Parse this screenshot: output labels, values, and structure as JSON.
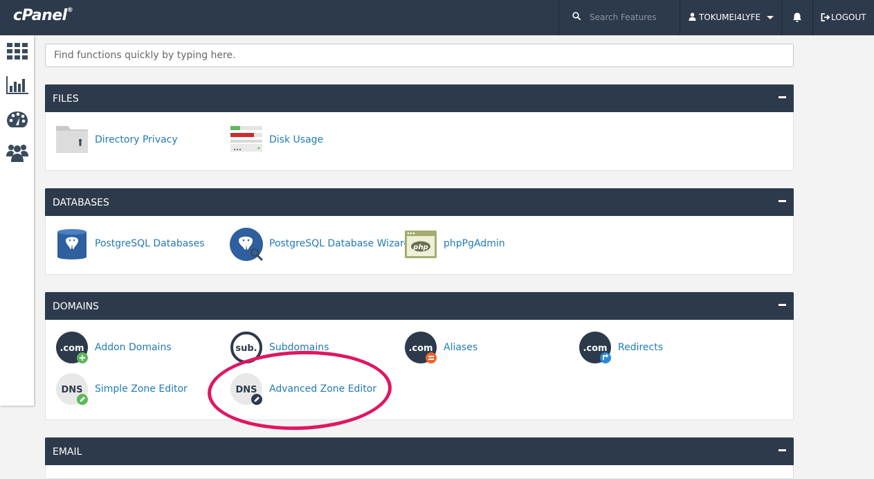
{
  "header": {
    "logo": "cPanel",
    "search_placeholder": "Search Features",
    "username": "TOKUMEI4LYFE",
    "logout_label": "LOGOUT"
  },
  "sidebar": {
    "items": [
      {
        "name": "home",
        "icon": "grid-icon"
      },
      {
        "name": "statistics",
        "icon": "bar-chart-icon"
      },
      {
        "name": "dashboard",
        "icon": "palette-icon"
      },
      {
        "name": "user-manager",
        "icon": "users-icon"
      }
    ]
  },
  "quick_search": {
    "placeholder": "Find functions quickly by typing here."
  },
  "sections": {
    "files": {
      "title": "FILES",
      "items": [
        "Directory Privacy",
        "Disk Usage"
      ]
    },
    "databases": {
      "title": "DATABASES",
      "items": [
        "PostgreSQL Databases",
        "PostgreSQL Database Wizard",
        "phpPgAdmin"
      ]
    },
    "domains": {
      "title": "DOMAINS",
      "items": [
        "Addon Domains",
        "Subdomains",
        "Aliases",
        "Redirects",
        "Simple Zone Editor",
        "Advanced Zone Editor"
      ]
    },
    "email": {
      "title": "EMAIL"
    }
  },
  "icon_text": {
    "com": ".com",
    "sub": "sub.",
    "dns": "DNS",
    "php": "php"
  },
  "colors": {
    "header_bg": "#2d3a4b",
    "link": "#1f7ab4",
    "highlight": "#e01663",
    "badge_green": "#5cb85c",
    "badge_orange": "#f0642a",
    "badge_blue": "#2b8ad4"
  }
}
